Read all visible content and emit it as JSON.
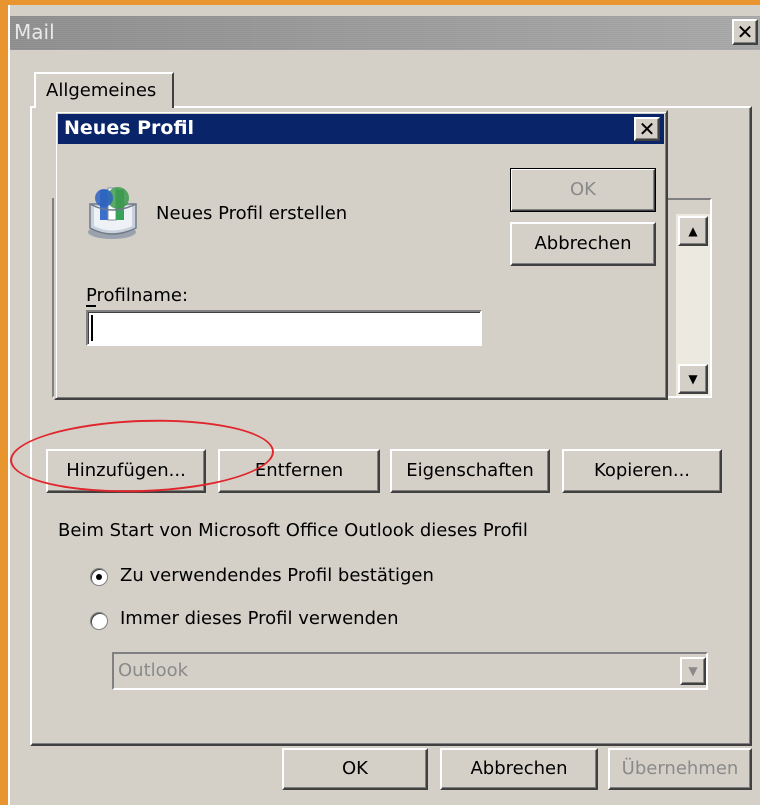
{
  "window": {
    "title": "Mail",
    "close_glyph": "✕"
  },
  "tab": {
    "label": "Allgemeines"
  },
  "dialog": {
    "title": "Neues Profil",
    "close_glyph": "✕",
    "heading": "Neues Profil erstellen",
    "ok_label": "OK",
    "cancel_label": "Abbrechen",
    "profile_name_label": "Profilname:",
    "profile_name_value": "",
    "icon": "mail-profile-icon"
  },
  "actions": {
    "add_label": "Hinzufügen...",
    "remove_label": "Entfernen",
    "properties_label": "Eigenschaften",
    "copy_label": "Kopieren..."
  },
  "startup": {
    "label": "Beim Start von Microsoft Office Outlook dieses Profil",
    "option_confirm": "Zu verwendendes Profil bestätigen",
    "option_always": "Immer dieses Profil verwenden",
    "selected": "option_confirm",
    "profile_select_value": "Outlook"
  },
  "footer": {
    "ok_label": "OK",
    "cancel_label": "Abbrechen",
    "apply_label": "Übernehmen"
  },
  "colors": {
    "face": "#d4d0c8",
    "dialog_title": "#0a246a",
    "accent_border": "#e8952f",
    "highlight_ellipse": "#e0262c"
  }
}
